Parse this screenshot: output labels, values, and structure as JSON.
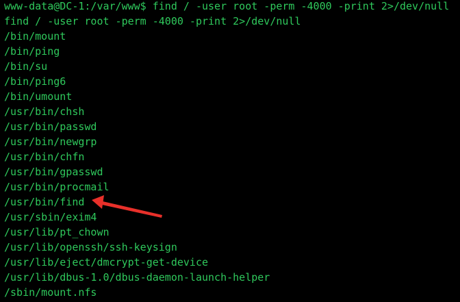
{
  "terminal": {
    "prompt": "www-data@DC-1:/var/www$",
    "command": " find / -user root -perm -4000 -print 2>/dev/null",
    "echo": "find / -user root -perm -4000 -print 2>/dev/null",
    "results": [
      "/bin/mount",
      "/bin/ping",
      "/bin/su",
      "/bin/ping6",
      "/bin/umount",
      "/usr/bin/chsh",
      "/usr/bin/passwd",
      "/usr/bin/newgrp",
      "/usr/bin/chfn",
      "/usr/bin/gpasswd",
      "/usr/bin/procmail",
      "/usr/bin/find",
      "/usr/sbin/exim4",
      "/usr/lib/pt_chown",
      "/usr/lib/openssh/ssh-keysign",
      "/usr/lib/eject/dmcrypt-get-device",
      "/usr/lib/dbus-1.0/dbus-daemon-launch-helper",
      "/sbin/mount.nfs"
    ],
    "text_color": "#2fc95c",
    "background_color": "#000000"
  },
  "annotation": {
    "icon": "red-arrow-icon",
    "color": "#e8302a",
    "points_to": "/usr/bin/find"
  }
}
